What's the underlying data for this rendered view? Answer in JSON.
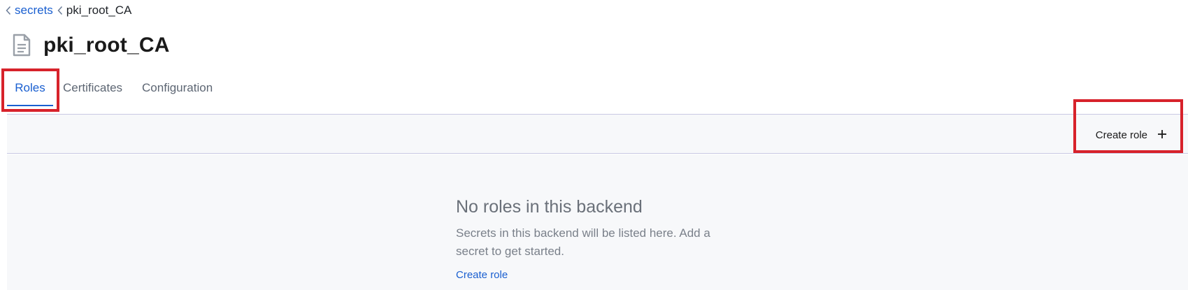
{
  "breadcrumb": {
    "items": [
      {
        "label": "secrets"
      },
      {
        "label": "pki_root_CA"
      }
    ]
  },
  "header": {
    "title": "pki_root_CA",
    "icon": "document-icon"
  },
  "tabs": [
    {
      "label": "Roles",
      "active": true
    },
    {
      "label": "Certificates",
      "active": false
    },
    {
      "label": "Configuration",
      "active": false
    }
  ],
  "toolbar": {
    "create_role_label": "Create role",
    "create_role_icon": "plus-icon"
  },
  "empty_state": {
    "title": "No roles in this backend",
    "body": "Secrets in this backend will be listed here. Add a secret to get started.",
    "link_label": "Create role"
  },
  "colors": {
    "accent": "#1a5fd0",
    "highlight": "#d7222b",
    "band_background": "#f7f8fa"
  }
}
